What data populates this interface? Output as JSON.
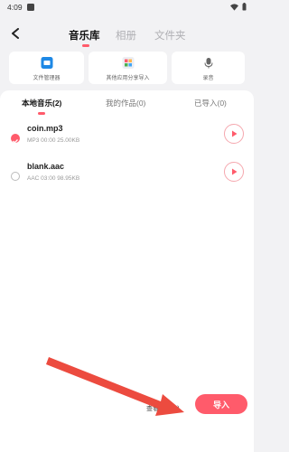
{
  "status": {
    "time": "4:09"
  },
  "header": {
    "tabs": [
      {
        "label": "音乐库",
        "active": true
      },
      {
        "label": "相册",
        "active": false
      },
      {
        "label": "文件夹",
        "active": false
      }
    ]
  },
  "tools": [
    {
      "label": "文件管理器",
      "icon": "folder-icon"
    },
    {
      "label": "其他应用分享导入",
      "icon": "apps-icon"
    },
    {
      "label": "录音",
      "icon": "microphone-icon"
    }
  ],
  "subtabs": [
    {
      "label": "本地音乐(2)",
      "active": true
    },
    {
      "label": "我的作品(0)",
      "active": false
    },
    {
      "label": "已导入(0)",
      "active": false
    }
  ],
  "files": [
    {
      "name": "coin.mp3",
      "meta": "MP3  00:00  25.00KB",
      "selected": true
    },
    {
      "name": "blank.aac",
      "meta": "AAC  03:00  98.95KB",
      "selected": false
    }
  ],
  "footer": {
    "selected_text": "查看已选(1)",
    "import_label": "导入"
  },
  "colors": {
    "accent": "#ff5b6b",
    "arrow": "#ec4b3f"
  }
}
